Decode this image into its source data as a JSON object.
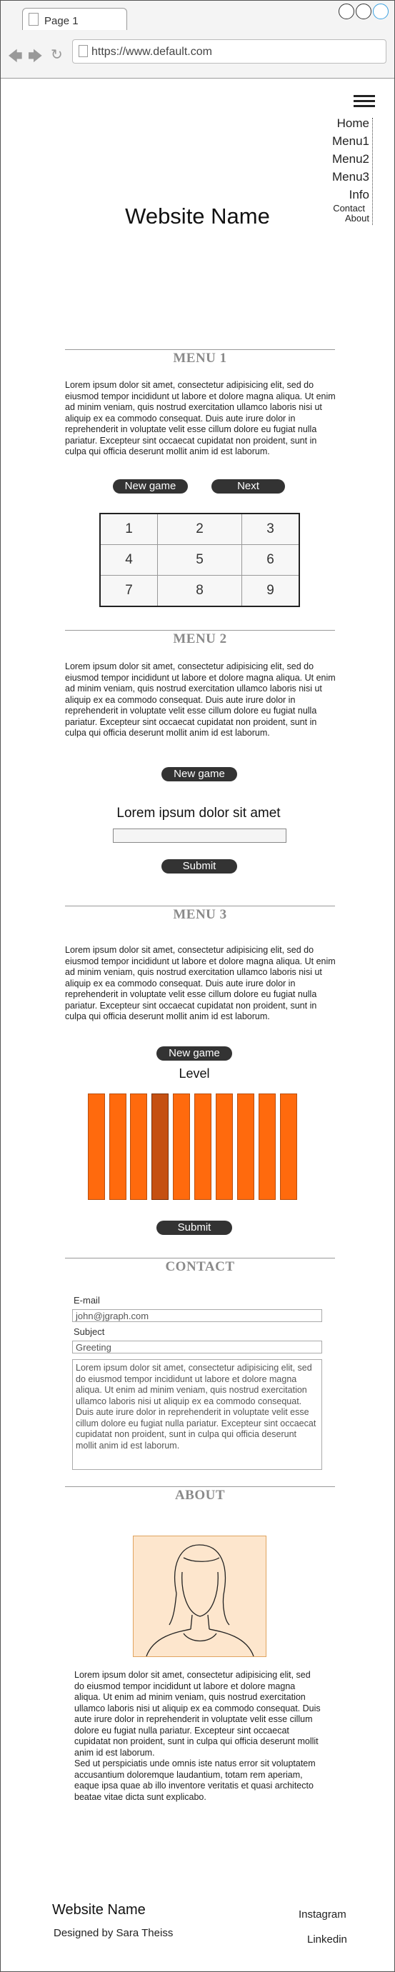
{
  "browser": {
    "tab_title": "Page 1",
    "url": "https://www.default.com"
  },
  "nav": {
    "items": [
      "Home",
      "Menu1",
      "Menu2",
      "Menu3",
      "Info"
    ],
    "small_items": [
      "Contact",
      "About"
    ]
  },
  "site": {
    "title": "Website Name"
  },
  "lorem": "Lorem ipsum dolor sit amet, consectetur adipisicing elit, sed do eiusmod tempor incididunt ut labore et dolore magna aliqua. Ut enim ad minim veniam, quis nostrud exercitation ullamco laboris nisi ut aliquip ex ea commodo consequat. Duis aute irure dolor in reprehenderit in voluptate velit esse cillum dolore eu fugiat nulla pariatur. Excepteur sint occaecat cupidatat non proident, sunt in culpa qui officia deserunt mollit anim id est laborum.",
  "menu1": {
    "heading": "MENU 1",
    "new_game": "New game",
    "next": "Next",
    "grid": [
      [
        "1",
        "2",
        "3"
      ],
      [
        "4",
        "5",
        "6"
      ],
      [
        "7",
        "8",
        "9"
      ]
    ]
  },
  "menu2": {
    "heading": "MENU 2",
    "new_game": "New game",
    "prompt": "Lorem ipsum dolor sit amet",
    "submit": "Submit"
  },
  "menu3": {
    "heading": "MENU 3",
    "new_game": "New game",
    "level_label": "Level",
    "level": {
      "selected": 4,
      "total": 10
    },
    "submit": "Submit",
    "colors": {
      "bar": "#ff6a0d",
      "selected_bar": "#c55012"
    }
  },
  "contact": {
    "heading": "CONTACT",
    "email_label": "E-mail",
    "email_value": "john@jgraph.com",
    "subject_label": "Subject",
    "subject_value": "Greeting"
  },
  "about": {
    "heading": "ABOUT",
    "text_extra": "Sed ut perspiciatis unde omnis iste natus error sit voluptatem accusantium doloremque laudantium, totam rem aperiam, eaque ipsa quae ab illo inventore veritatis et quasi architecto beatae vitae dicta sunt explicabo."
  },
  "footer": {
    "name": "Website Name",
    "designed_by": "Designed by Sara Theiss",
    "instagram": "Instagram",
    "linkedin": "Linkedin"
  }
}
